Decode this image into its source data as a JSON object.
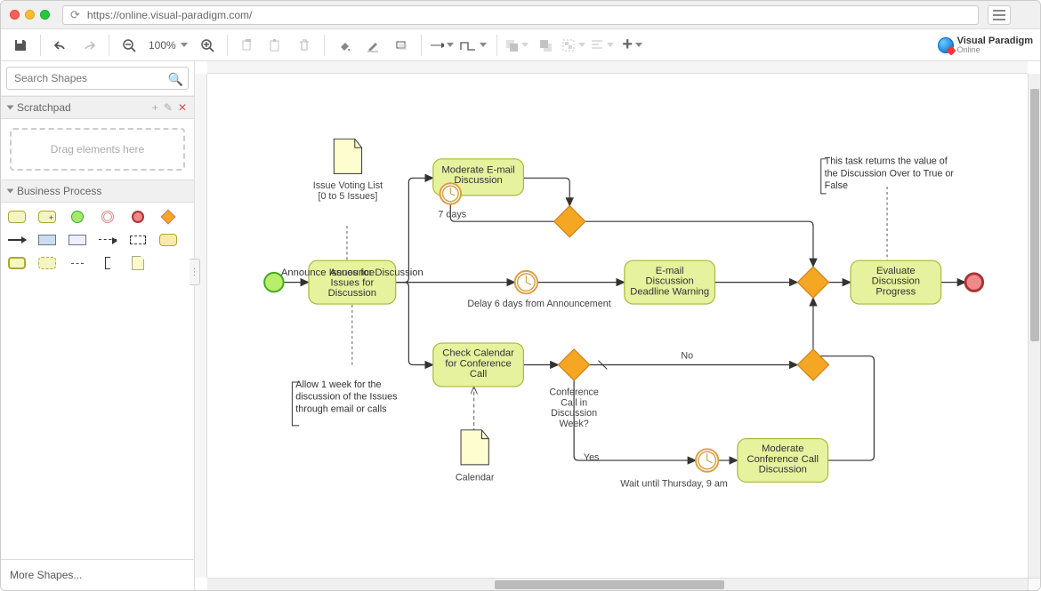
{
  "url": "https://online.visual-paradigm.com/",
  "logo": {
    "line1": "Visual Paradigm",
    "line2": "Online"
  },
  "toolbar": {
    "zoom": "100%",
    "icons": [
      "save",
      "undo",
      "redo",
      "zoom-out",
      "zoom-level",
      "zoom-in",
      "copy",
      "paste",
      "delete",
      "fill",
      "stroke",
      "shadow",
      "line-start",
      "line-style",
      "to-front",
      "to-back",
      "group",
      "align",
      "add"
    ]
  },
  "sidebar": {
    "search_ph": "Search Shapes",
    "scratchpad_title": "Scratchpad",
    "drag_hint": "Drag elements here",
    "bp_title": "Business Process",
    "more": "More Shapes..."
  },
  "diagram": {
    "start": "start",
    "tasks": {
      "announce": "Announce Issues for Discussion",
      "moderate_email": "Moderate E-mail Discussion",
      "email_warning": "E-mail Discussion Deadline Warning",
      "check_cal": "Check Calendar for Conference Call",
      "moderate_call": "Moderate Conference Call Discussion",
      "evaluate": "Evaluate Discussion Progress"
    },
    "labels": {
      "seven_days": "7 days",
      "delay6": "Delay 6 days from Announcement",
      "conf_q1": "Conference",
      "conf_q2": "Call in",
      "conf_q3": "Discussion",
      "conf_q4": "Week?",
      "no": "No",
      "yes": "Yes",
      "wait_thu": "Wait until Thursday, 9 am",
      "issue_list1": "Issue Voting List",
      "issue_list2": "[0 to 5 Issues]",
      "calendar": "Calendar",
      "allow_week": "Allow 1 week for the discussion of the Issues through email or calls",
      "returns": "This task returns the value of the Discussion Over to True or False"
    }
  }
}
